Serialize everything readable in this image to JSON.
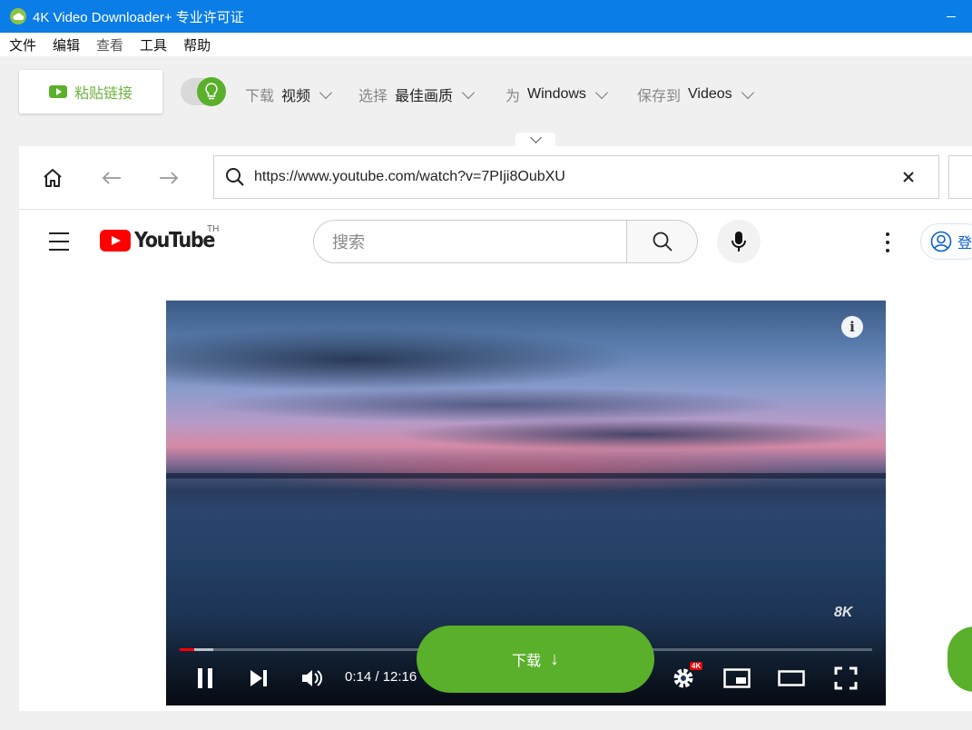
{
  "window": {
    "title": "4K Video Downloader+ 专业许可证"
  },
  "menu": [
    "文件",
    "编辑",
    "查看",
    "工具",
    "帮助"
  ],
  "toolbar": {
    "paste_label": "粘贴链接",
    "download_label": "下载",
    "download_value": "视频",
    "select_label": "选择",
    "select_value": "最佳画质",
    "for_label": "为",
    "for_value": "Windows",
    "saveto_label": "保存到",
    "saveto_value": "Videos"
  },
  "browser": {
    "url": "https://www.youtube.com/watch?v=7PIji8OubXU"
  },
  "youtube": {
    "logo_text": "YouTube",
    "country": "TH",
    "search_placeholder": "搜索",
    "signin_label": "登"
  },
  "player": {
    "time": "0:14 / 12:16",
    "watermark": "8K",
    "quality_badge": "4K",
    "progress_played": 0.021,
    "progress_loaded": 0.048
  },
  "download_button": {
    "label": "下载",
    "arrow": "↓"
  },
  "colors": {
    "accent": "#5ab02a",
    "titlebar": "#0a7de6",
    "youtube_red": "#ff0000"
  },
  "icons": [
    "app-logo-icon",
    "minimize-icon",
    "youtube-play-icon",
    "bulb-icon",
    "home-icon",
    "back-arrow-icon",
    "forward-arrow-icon",
    "search-icon",
    "close-icon",
    "menu-icon",
    "mic-icon",
    "more-vert-icon",
    "user-icon",
    "info-icon",
    "pause-icon",
    "next-icon",
    "volume-icon",
    "settings-icon",
    "miniplayer-icon",
    "theater-icon",
    "fullscreen-icon"
  ]
}
